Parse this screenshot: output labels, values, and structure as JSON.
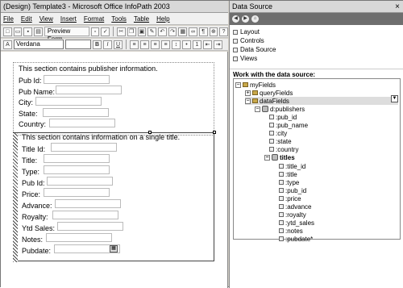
{
  "window": {
    "title": "(Design) Template3 - Microsoft Office InfoPath 2003"
  },
  "menu": {
    "items": [
      "File",
      "Edit",
      "View",
      "Insert",
      "Format",
      "Tools",
      "Table",
      "Help"
    ]
  },
  "toolbar": {
    "preview_label": "Preview Form",
    "font_name": "Verdana",
    "bold": "B",
    "italic": "I",
    "underline": "U"
  },
  "form": {
    "section1_text": "This section contains publisher information.",
    "section1_fields": [
      "Pub Id:",
      "Pub Name:",
      "City:",
      "State:",
      "Country:"
    ],
    "section2_text": "This section contains information on a single title.",
    "section2_fields": [
      "Title Id:",
      "Title:",
      "Type:",
      "Pub Id:",
      "Price:",
      "Advance:",
      "Royalty:",
      "Ytd Sales:",
      "Notes:",
      "Pubdate:"
    ]
  },
  "taskpane": {
    "title": "Data Source",
    "links": [
      "Layout",
      "Controls",
      "Data Source",
      "Views"
    ],
    "work_heading": "Work with the data source:",
    "tree": {
      "root": "myFields",
      "query": "queryFields",
      "data": "dataFields",
      "group": "d:publishers",
      "group_fields": [
        ":pub_id",
        ":pub_name",
        ":city",
        ":state",
        ":country"
      ],
      "titles": "titles",
      "title_fields": [
        ":title_id",
        ":title",
        ":type",
        ":pub_id",
        ":price",
        ":advance",
        ":royalty",
        ":ytd_sales",
        ":notes",
        ":pubdate*"
      ]
    }
  }
}
